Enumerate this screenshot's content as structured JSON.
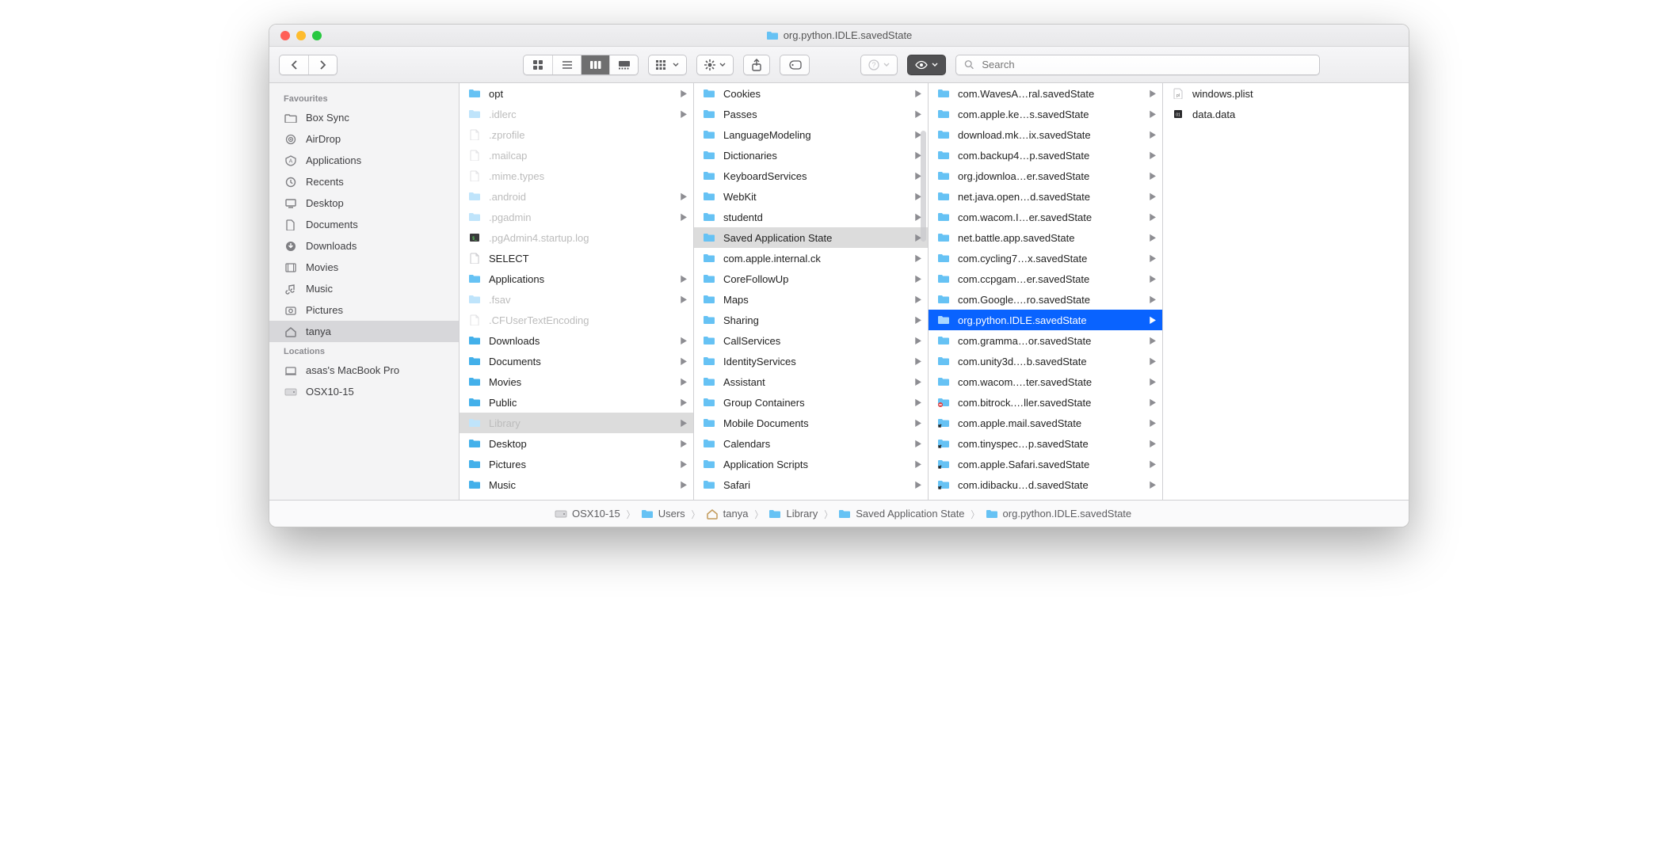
{
  "window_title": "org.python.IDLE.savedState",
  "search_placeholder": "Search",
  "sidebar": {
    "sections": [
      {
        "header": "Favourites",
        "items": [
          {
            "icon": "folder-outline",
            "label": "Box Sync"
          },
          {
            "icon": "airdrop",
            "label": "AirDrop"
          },
          {
            "icon": "applications",
            "label": "Applications"
          },
          {
            "icon": "recents",
            "label": "Recents"
          },
          {
            "icon": "desktop",
            "label": "Desktop"
          },
          {
            "icon": "documents",
            "label": "Documents"
          },
          {
            "icon": "downloads",
            "label": "Downloads"
          },
          {
            "icon": "movies",
            "label": "Movies"
          },
          {
            "icon": "music",
            "label": "Music"
          },
          {
            "icon": "pictures",
            "label": "Pictures"
          },
          {
            "icon": "home",
            "label": "tanya",
            "selected": true
          }
        ]
      },
      {
        "header": "Locations",
        "items": [
          {
            "icon": "mac",
            "label": "asas's MacBook Pro"
          },
          {
            "icon": "drive",
            "label": "OSX10-15"
          }
        ]
      }
    ]
  },
  "columns": [
    {
      "items": [
        {
          "t": "folder",
          "label": "opt",
          "arrow": true
        },
        {
          "t": "folder-dim",
          "label": ".idlerc",
          "arrow": true,
          "dim": true
        },
        {
          "t": "file-dim",
          "label": ".zprofile",
          "dim": true
        },
        {
          "t": "file-dim",
          "label": ".mailcap",
          "dim": true
        },
        {
          "t": "file-dim",
          "label": ".mime.types",
          "dim": true
        },
        {
          "t": "folder-dim",
          "label": ".android",
          "arrow": true,
          "dim": true
        },
        {
          "t": "folder-dim",
          "label": ".pgadmin",
          "arrow": true,
          "dim": true
        },
        {
          "t": "exec-dim",
          "label": ".pgAdmin4.startup.log",
          "dim": true
        },
        {
          "t": "file",
          "label": "SELECT"
        },
        {
          "t": "folder",
          "label": "Applications",
          "arrow": true
        },
        {
          "t": "folder-dim",
          "label": ".fsav",
          "arrow": true,
          "dim": true
        },
        {
          "t": "file-dim",
          "label": ".CFUserTextEncoding",
          "dim": true
        },
        {
          "t": "folder-dl",
          "label": "Downloads",
          "arrow": true
        },
        {
          "t": "folder-doc",
          "label": "Documents",
          "arrow": true
        },
        {
          "t": "folder-mov",
          "label": "Movies",
          "arrow": true
        },
        {
          "t": "folder-pub",
          "label": "Public",
          "arrow": true
        },
        {
          "t": "folder-dim",
          "label": "Library",
          "arrow": true,
          "dim": true,
          "sel": "gray"
        },
        {
          "t": "folder-desk",
          "label": "Desktop",
          "arrow": true
        },
        {
          "t": "folder-pic",
          "label": "Pictures",
          "arrow": true
        },
        {
          "t": "folder-mus",
          "label": "Music",
          "arrow": true
        }
      ]
    },
    {
      "scrollbar": true,
      "items": [
        {
          "t": "folder",
          "label": "Cookies",
          "arrow": true
        },
        {
          "t": "folder",
          "label": "Passes",
          "arrow": true
        },
        {
          "t": "folder",
          "label": "LanguageModeling",
          "arrow": true
        },
        {
          "t": "folder",
          "label": "Dictionaries",
          "arrow": true
        },
        {
          "t": "folder",
          "label": "KeyboardServices",
          "arrow": true
        },
        {
          "t": "folder",
          "label": "WebKit",
          "arrow": true
        },
        {
          "t": "folder",
          "label": "studentd",
          "arrow": true
        },
        {
          "t": "folder",
          "label": "Saved Application State",
          "arrow": true,
          "sel": "gray"
        },
        {
          "t": "folder",
          "label": "com.apple.internal.ck",
          "arrow": true
        },
        {
          "t": "folder",
          "label": "CoreFollowUp",
          "arrow": true
        },
        {
          "t": "folder",
          "label": "Maps",
          "arrow": true
        },
        {
          "t": "folder",
          "label": "Sharing",
          "arrow": true
        },
        {
          "t": "folder",
          "label": "CallServices",
          "arrow": true
        },
        {
          "t": "folder",
          "label": "IdentityServices",
          "arrow": true
        },
        {
          "t": "folder",
          "label": "Assistant",
          "arrow": true
        },
        {
          "t": "folder",
          "label": "Group Containers",
          "arrow": true
        },
        {
          "t": "folder",
          "label": "Mobile Documents",
          "arrow": true
        },
        {
          "t": "folder",
          "label": "Calendars",
          "arrow": true
        },
        {
          "t": "folder",
          "label": "Application Scripts",
          "arrow": true
        },
        {
          "t": "folder",
          "label": "Safari",
          "arrow": true
        }
      ]
    },
    {
      "items": [
        {
          "t": "folder",
          "label": "com.WavesA…ral.savedState",
          "arrow": true
        },
        {
          "t": "folder",
          "label": "com.apple.ke…s.savedState",
          "arrow": true
        },
        {
          "t": "folder",
          "label": "download.mk…ix.savedState",
          "arrow": true
        },
        {
          "t": "folder",
          "label": "com.backup4…p.savedState",
          "arrow": true
        },
        {
          "t": "folder",
          "label": "org.jdownloa…er.savedState",
          "arrow": true
        },
        {
          "t": "folder",
          "label": "net.java.open…d.savedState",
          "arrow": true
        },
        {
          "t": "folder",
          "label": "com.wacom.I…er.savedState",
          "arrow": true
        },
        {
          "t": "folder",
          "label": "net.battle.app.savedState",
          "arrow": true
        },
        {
          "t": "folder",
          "label": "com.cycling7…x.savedState",
          "arrow": true
        },
        {
          "t": "folder",
          "label": "com.ccpgam…er.savedState",
          "arrow": true
        },
        {
          "t": "folder",
          "label": "com.Google.…ro.savedState",
          "arrow": true
        },
        {
          "t": "folder",
          "label": "org.python.IDLE.savedState",
          "arrow": true,
          "sel": "blue"
        },
        {
          "t": "folder",
          "label": "com.gramma…or.savedState",
          "arrow": true
        },
        {
          "t": "folder",
          "label": "com.unity3d.…b.savedState",
          "arrow": true
        },
        {
          "t": "folder",
          "label": "com.wacom.…ter.savedState",
          "arrow": true
        },
        {
          "t": "folder-no",
          "label": "com.bitrock.…ller.savedState",
          "arrow": true
        },
        {
          "t": "folder-alias",
          "label": "com.apple.mail.savedState",
          "arrow": true
        },
        {
          "t": "folder-alias",
          "label": "com.tinyspec…p.savedState",
          "arrow": true
        },
        {
          "t": "folder-alias",
          "label": "com.apple.Safari.savedState",
          "arrow": true
        },
        {
          "t": "folder-alias",
          "label": "com.idibacku…d.savedState",
          "arrow": true
        }
      ]
    },
    {
      "items": [
        {
          "t": "plist",
          "label": "windows.plist"
        },
        {
          "t": "data",
          "label": "data.data"
        }
      ]
    }
  ],
  "path": [
    {
      "icon": "drive",
      "label": "OSX10-15"
    },
    {
      "icon": "folder",
      "label": "Users"
    },
    {
      "icon": "home",
      "label": "tanya"
    },
    {
      "icon": "folder",
      "label": "Library"
    },
    {
      "icon": "folder",
      "label": "Saved Application State"
    },
    {
      "icon": "folder",
      "label": "org.python.IDLE.savedState"
    }
  ]
}
